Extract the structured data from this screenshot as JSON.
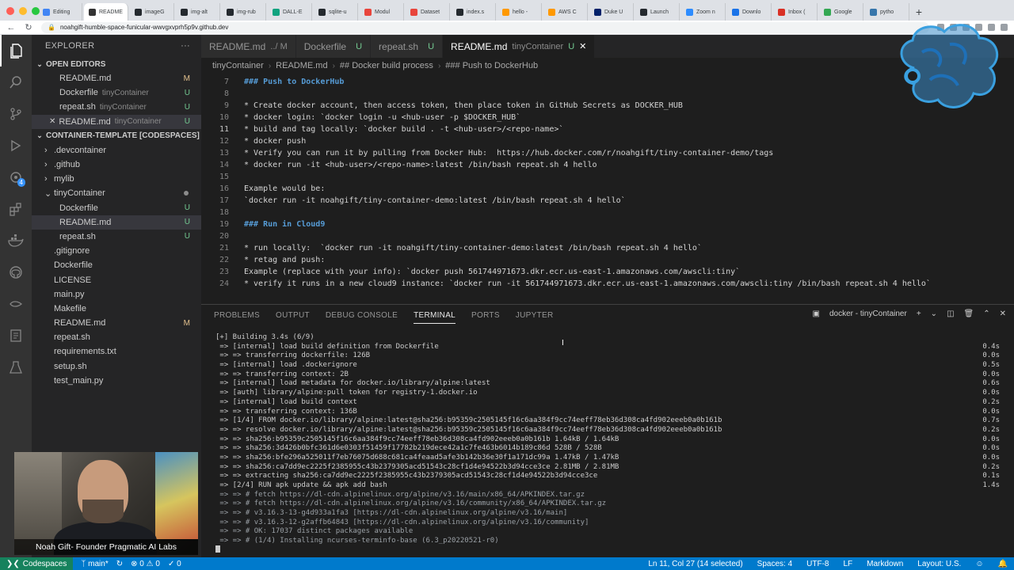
{
  "browser": {
    "tabs": [
      {
        "label": "Editing",
        "color": "#4285f4"
      },
      {
        "label": "README",
        "color": "#333333",
        "active": true
      },
      {
        "label": "imageG",
        "color": "#24292e"
      },
      {
        "label": "img-alt",
        "color": "#24292e"
      },
      {
        "label": "img-rub",
        "color": "#24292e"
      },
      {
        "label": "DALL-E",
        "color": "#10a37f"
      },
      {
        "label": "sqlite-u",
        "color": "#24292e"
      },
      {
        "label": "Modul",
        "color": "#e8453c"
      },
      {
        "label": "Dataset",
        "color": "#e8453c"
      },
      {
        "label": "index.s",
        "color": "#24292e"
      },
      {
        "label": "hello -",
        "color": "#ff9900"
      },
      {
        "label": "AWS C",
        "color": "#ff9900"
      },
      {
        "label": "Duke U",
        "color": "#012169"
      },
      {
        "label": "Launch",
        "color": "#24292e"
      },
      {
        "label": "Zoom n",
        "color": "#2d8cff"
      },
      {
        "label": "Downlo",
        "color": "#1a73e8"
      },
      {
        "label": "Inbox (",
        "color": "#d93025"
      },
      {
        "label": "Google",
        "color": "#34a853"
      },
      {
        "label": "pytho",
        "color": "#3776ab"
      }
    ],
    "url": "noahgift-humble-space-funicular-wwvgxvprh5p9v.github.dev"
  },
  "activity_icons": [
    "files-icon",
    "search-icon",
    "source-control-icon",
    "run-debug-icon",
    "remote-explorer-icon",
    "extensions-icon",
    "docker-icon",
    "github-icon",
    "accounts-icon",
    "settings-icon"
  ],
  "sidebar": {
    "title": "EXPLORER",
    "open_editors": {
      "title": "OPEN EDITORS",
      "items": [
        {
          "name": "README.md",
          "desc": "",
          "git": "M"
        },
        {
          "name": "Dockerfile",
          "desc": "tinyContainer",
          "git": "U"
        },
        {
          "name": "repeat.sh",
          "desc": "tinyContainer",
          "git": "U"
        },
        {
          "name": "README.md",
          "desc": "tinyContainer",
          "git": "U"
        }
      ]
    },
    "workspace": {
      "title": "CONTAINER-TEMPLATE [CODESPACES]",
      "items": [
        {
          "name": ".devcontainer",
          "type": "folder",
          "indent": 1
        },
        {
          "name": ".github",
          "type": "folder",
          "indent": 1
        },
        {
          "name": "mylib",
          "type": "folder",
          "indent": 1
        },
        {
          "name": "tinyContainer",
          "type": "folder-open",
          "indent": 1
        },
        {
          "name": "Dockerfile",
          "type": "file",
          "indent": 2,
          "git": "U"
        },
        {
          "name": "README.md",
          "type": "file",
          "indent": 2,
          "git": "U"
        },
        {
          "name": "repeat.sh",
          "type": "file",
          "indent": 2,
          "git": "U"
        },
        {
          "name": ".gitignore",
          "type": "file",
          "indent": 1
        },
        {
          "name": "Dockerfile",
          "type": "file",
          "indent": 1
        },
        {
          "name": "LICENSE",
          "type": "file",
          "indent": 1
        },
        {
          "name": "main.py",
          "type": "file",
          "indent": 1
        },
        {
          "name": "Makefile",
          "type": "file",
          "indent": 1
        },
        {
          "name": "README.md",
          "type": "file",
          "indent": 1,
          "git": "M"
        },
        {
          "name": "repeat.sh",
          "type": "file",
          "indent": 1
        },
        {
          "name": "requirements.txt",
          "type": "file",
          "indent": 1
        },
        {
          "name": "setup.sh",
          "type": "file",
          "indent": 1
        },
        {
          "name": "test_main.py",
          "type": "file",
          "indent": 1
        }
      ]
    }
  },
  "editor_tabs": [
    {
      "name": "README.md",
      "desc": "../ M",
      "git": ""
    },
    {
      "name": "Dockerfile",
      "desc": "",
      "git": "U"
    },
    {
      "name": "repeat.sh",
      "desc": "",
      "git": "U"
    },
    {
      "name": "README.md",
      "desc": "tinyContainer",
      "git": "U"
    }
  ],
  "breadcrumb": [
    "tinyContainer",
    "README.md",
    "## Docker build process",
    "### Push to DockerHub"
  ],
  "code": [
    {
      "n": "7",
      "t": "### Push to DockerHub",
      "kind": "h"
    },
    {
      "n": "8",
      "t": "",
      "kind": "p"
    },
    {
      "n": "9",
      "t": "* Create docker account, then access token, then place token in GitHub Secrets as DOCKER_HUB",
      "kind": "b"
    },
    {
      "n": "10",
      "t": "* docker login: `docker login -u <hub-user -p $DOCKER_HUB`",
      "kind": "b"
    },
    {
      "n": "11",
      "t": "* build and tag locally: `docker build . -t <hub-user>/<repo-name>`",
      "kind": "b"
    },
    {
      "n": "12",
      "t": "* docker push",
      "kind": "b"
    },
    {
      "n": "13",
      "t": "* Verify you can run it by pulling from Docker Hub:  https://hub.docker.com/r/noahgift/tiny-container-demo/tags",
      "kind": "b"
    },
    {
      "n": "14",
      "t": "* docker run -it <hub-user>/<repo-name>:latest /bin/bash repeat.sh 4 hello",
      "kind": "b"
    },
    {
      "n": "15",
      "t": "",
      "kind": "p"
    },
    {
      "n": "16",
      "t": "Example would be:",
      "kind": "p"
    },
    {
      "n": "17",
      "t": "`docker run -it noahgift/tiny-container-demo:latest /bin/bash repeat.sh 4 hello`",
      "kind": "p"
    },
    {
      "n": "18",
      "t": "",
      "kind": "p"
    },
    {
      "n": "19",
      "t": "### Run in Cloud9",
      "kind": "h"
    },
    {
      "n": "20",
      "t": "",
      "kind": "p"
    },
    {
      "n": "21",
      "t": "* run locally:  `docker run -it noahgift/tiny-container-demo:latest /bin/bash repeat.sh 4 hello`",
      "kind": "b"
    },
    {
      "n": "22",
      "t": "* retag and push:",
      "kind": "b"
    },
    {
      "n": "23",
      "t": "Example (replace with your info): `docker push 561744971673.dkr.ecr.us-east-1.amazonaws.com/awscli:tiny`",
      "kind": "p"
    },
    {
      "n": "24",
      "t": "* verify it runs in a new cloud9 instance: `docker run -it 561744971673.dkr.ecr.us-east-1.amazonaws.com/awscli:tiny /bin/bash repeat.sh 4 hello`",
      "kind": "b"
    }
  ],
  "panel": {
    "tabs": [
      "PROBLEMS",
      "OUTPUT",
      "DEBUG CONSOLE",
      "TERMINAL",
      "PORTS",
      "JUPYTER"
    ],
    "active_tab": "TERMINAL",
    "terminal_name": "docker - tinyContainer"
  },
  "terminal": [
    {
      "t": "[+] Building 3.4s (6/9)",
      "m": "",
      "dim": false
    },
    {
      "t": " => [internal] load build definition from Dockerfile",
      "m": "0.4s",
      "dim": false
    },
    {
      "t": " => => transferring dockerfile: 126B",
      "m": "0.0s",
      "dim": false
    },
    {
      "t": " => [internal] load .dockerignore",
      "m": "0.5s",
      "dim": false
    },
    {
      "t": " => => transferring context: 2B",
      "m": "0.0s",
      "dim": false
    },
    {
      "t": " => [internal] load metadata for docker.io/library/alpine:latest",
      "m": "0.6s",
      "dim": false
    },
    {
      "t": " => [auth] library/alpine:pull token for registry-1.docker.io",
      "m": "0.0s",
      "dim": false
    },
    {
      "t": " => [internal] load build context",
      "m": "0.2s",
      "dim": false
    },
    {
      "t": " => => transferring context: 136B",
      "m": "0.0s",
      "dim": false
    },
    {
      "t": " => [1/4] FROM docker.io/library/alpine:latest@sha256:b95359c2505145f16c6aa384f9cc74eeff78eb36d308ca4fd902eeeb0a0b161b",
      "m": "0.7s",
      "dim": false
    },
    {
      "t": " => => resolve docker.io/library/alpine:latest@sha256:b95359c2505145f16c6aa384f9cc74eeff78eb36d308ca4fd902eeeb0a0b161b",
      "m": "0.2s",
      "dim": false
    },
    {
      "t": " => => sha256:b95359c2505145f16c6aa384f9cc74eeff78eb36d308ca4fd902eeeb0a0b161b 1.64kB / 1.64kB",
      "m": "0.0s",
      "dim": false
    },
    {
      "t": " => => sha256:3d426b0bfc361d6e0303f51459f17782b219dece42a1c7fe463b6014b189c86d 528B / 528B",
      "m": "0.0s",
      "dim": false
    },
    {
      "t": " => => sha256:bfe296a525011f7eb76075d688c681ca4feaad5afe3b142b36e30f1a171dc99a 1.47kB / 1.47kB",
      "m": "0.0s",
      "dim": false
    },
    {
      "t": " => => sha256:ca7dd9ec2225f2385955c43b2379305acd51543c28cf1d4e94522b3d94cce3ce 2.81MB / 2.81MB",
      "m": "0.2s",
      "dim": false
    },
    {
      "t": " => => extracting sha256:ca7dd9ec2225f2385955c43b2379305acd51543c28cf1d4e94522b3d94cce3ce",
      "m": "0.1s",
      "dim": false
    },
    {
      "t": " => [2/4] RUN apk update && apk add bash",
      "m": "1.4s",
      "dim": false
    },
    {
      "t": " => => # fetch https://dl-cdn.alpinelinux.org/alpine/v3.16/main/x86_64/APKINDEX.tar.gz",
      "m": "",
      "dim": true
    },
    {
      "t": " => => # fetch https://dl-cdn.alpinelinux.org/alpine/v3.16/community/x86_64/APKINDEX.tar.gz",
      "m": "",
      "dim": true
    },
    {
      "t": " => => # v3.16.3-13-g4d933a1fa3 [https://dl-cdn.alpinelinux.org/alpine/v3.16/main]",
      "m": "",
      "dim": true
    },
    {
      "t": " => => # v3.16.3-12-g2affb64843 [https://dl-cdn.alpinelinux.org/alpine/v3.16/community]",
      "m": "",
      "dim": true
    },
    {
      "t": " => => # OK: 17037 distinct packages available",
      "m": "",
      "dim": true
    },
    {
      "t": " => => # (1/4) Installing ncurses-terminfo-base (6.3_p20220521-r0)",
      "m": "",
      "dim": true
    }
  ],
  "webcam": {
    "caption": "Noah Gift- Founder Pragmatic AI Labs"
  },
  "status": {
    "remote": "Codespaces",
    "branch": "main*",
    "errors": "0",
    "warnings": "0",
    "ports": "0",
    "position": "Ln 11, Col 27 (14 selected)",
    "spaces": "Spaces: 4",
    "encoding": "UTF-8",
    "eol": "LF",
    "language": "Markdown",
    "layout": "Layout: U.S."
  },
  "colors": {
    "accent": "#007acc",
    "remote": "#16825d",
    "modified": "#e2c08d",
    "untracked": "#73c991"
  }
}
